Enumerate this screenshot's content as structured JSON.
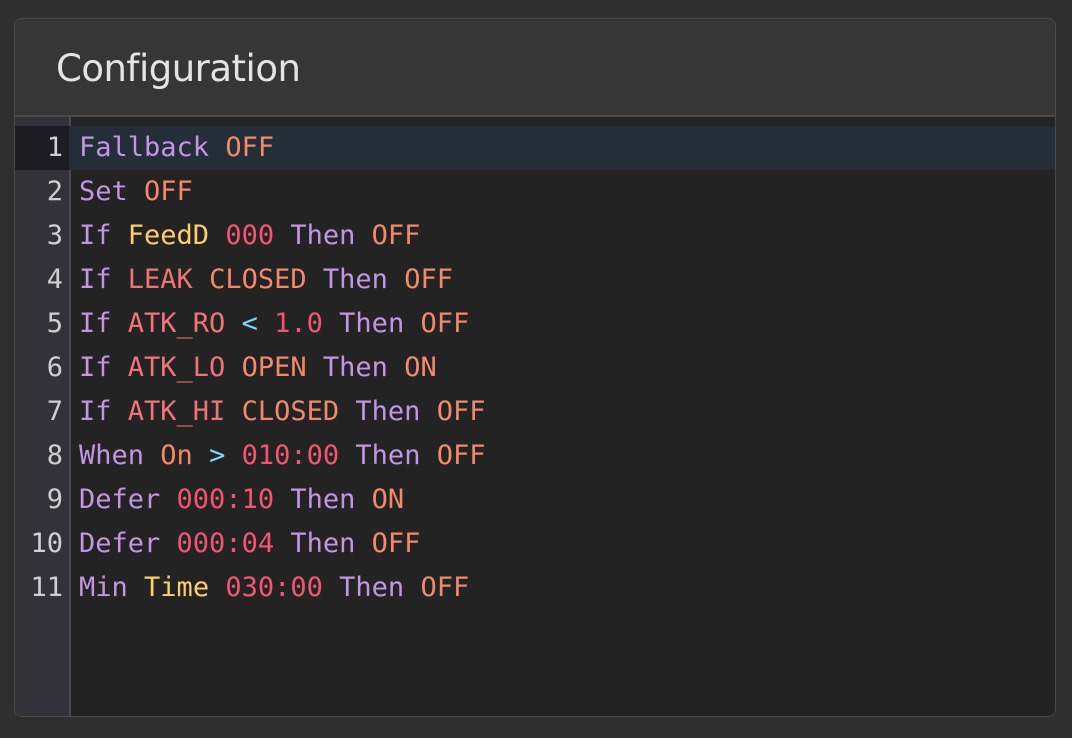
{
  "panel": {
    "title": "Configuration"
  },
  "editor": {
    "active_line": 1,
    "lines": [
      {
        "n": "1",
        "tokens": [
          [
            "kw",
            "Fallback"
          ],
          [
            "st",
            "OFF"
          ]
        ]
      },
      {
        "n": "2",
        "tokens": [
          [
            "kw",
            "Set"
          ],
          [
            "st",
            "OFF"
          ]
        ]
      },
      {
        "n": "3",
        "tokens": [
          [
            "kw",
            "If"
          ],
          [
            "vr",
            "FeedD"
          ],
          [
            "nm",
            "000"
          ],
          [
            "kw",
            "Then"
          ],
          [
            "st",
            "OFF"
          ]
        ]
      },
      {
        "n": "4",
        "tokens": [
          [
            "kw",
            "If"
          ],
          [
            "id",
            "LEAK"
          ],
          [
            "st",
            "CLOSED"
          ],
          [
            "kw",
            "Then"
          ],
          [
            "st",
            "OFF"
          ]
        ]
      },
      {
        "n": "5",
        "tokens": [
          [
            "kw",
            "If"
          ],
          [
            "id",
            "ATK_RO"
          ],
          [
            "op",
            "<"
          ],
          [
            "nm",
            "1.0"
          ],
          [
            "kw",
            "Then"
          ],
          [
            "st",
            "OFF"
          ]
        ]
      },
      {
        "n": "6",
        "tokens": [
          [
            "kw",
            "If"
          ],
          [
            "id",
            "ATK_LO"
          ],
          [
            "st",
            "OPEN"
          ],
          [
            "kw",
            "Then"
          ],
          [
            "st",
            "ON"
          ]
        ]
      },
      {
        "n": "7",
        "tokens": [
          [
            "kw",
            "If"
          ],
          [
            "id",
            "ATK_HI"
          ],
          [
            "st",
            "CLOSED"
          ],
          [
            "kw",
            "Then"
          ],
          [
            "st",
            "OFF"
          ]
        ]
      },
      {
        "n": "8",
        "tokens": [
          [
            "kw",
            "When"
          ],
          [
            "st",
            "On"
          ],
          [
            "op",
            ">"
          ],
          [
            "nm",
            "010:00"
          ],
          [
            "kw",
            "Then"
          ],
          [
            "st",
            "OFF"
          ]
        ]
      },
      {
        "n": "9",
        "tokens": [
          [
            "kw",
            "Defer"
          ],
          [
            "nm",
            "000:10"
          ],
          [
            "kw",
            "Then"
          ],
          [
            "st",
            "ON"
          ]
        ]
      },
      {
        "n": "10",
        "tokens": [
          [
            "kw",
            "Defer"
          ],
          [
            "nm",
            "000:04"
          ],
          [
            "kw",
            "Then"
          ],
          [
            "st",
            "OFF"
          ]
        ]
      },
      {
        "n": "11",
        "tokens": [
          [
            "kw",
            "Min"
          ],
          [
            "vr",
            "Time"
          ],
          [
            "nm",
            "030:00"
          ],
          [
            "kw",
            "Then"
          ],
          [
            "st",
            "OFF"
          ]
        ]
      }
    ]
  },
  "colors": {
    "keyword": "#c395e2",
    "state": "#f1896a",
    "variable": "#ffcc6e",
    "number": "#f2566e",
    "identifier": "#f07378",
    "operator": "#7fd6f7",
    "active_line_bg": "#232e38"
  }
}
